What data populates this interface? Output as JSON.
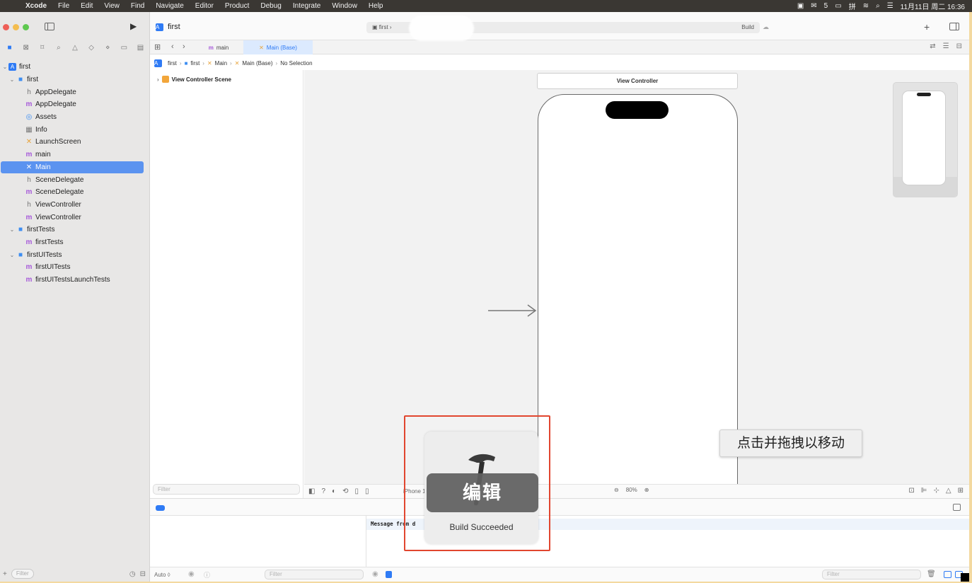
{
  "menubar": {
    "app": "Xcode",
    "items": [
      "File",
      "Edit",
      "View",
      "Find",
      "Navigate",
      "Editor",
      "Product",
      "Debug",
      "Integrate",
      "Window",
      "Help"
    ],
    "status": {
      "wechat_count": "5",
      "ime_badge": "拼",
      "datetime": "11月11日 周二 16:36"
    }
  },
  "toolbar": {
    "project_title": "first",
    "scheme": "first",
    "activity_status": "Build"
  },
  "navigator": {
    "tree": [
      {
        "label": "first",
        "icon": "project-icon",
        "level": 0,
        "disclosure": "open"
      },
      {
        "label": "first",
        "icon": "folder-icon",
        "level": 1,
        "disclosure": "open"
      },
      {
        "label": "AppDelegate",
        "icon": "h-file-icon",
        "level": 2
      },
      {
        "label": "AppDelegate",
        "icon": "m-file-icon",
        "level": 2
      },
      {
        "label": "Assets",
        "icon": "assets-icon",
        "level": 2
      },
      {
        "label": "Info",
        "icon": "plist-icon",
        "level": 2
      },
      {
        "label": "LaunchScreen",
        "icon": "storyboard-icon",
        "level": 2
      },
      {
        "label": "main",
        "icon": "m-file-icon",
        "level": 2
      },
      {
        "label": "Main",
        "icon": "storyboard-icon",
        "level": 2,
        "selected": true
      },
      {
        "label": "SceneDelegate",
        "icon": "h-file-icon",
        "level": 2
      },
      {
        "label": "SceneDelegate",
        "icon": "m-file-icon",
        "level": 2
      },
      {
        "label": "ViewController",
        "icon": "h-file-icon",
        "level": 2
      },
      {
        "label": "ViewController",
        "icon": "m-file-icon",
        "level": 2
      },
      {
        "label": "firstTests",
        "icon": "folder-icon",
        "level": 1,
        "disclosure": "open"
      },
      {
        "label": "firstTests",
        "icon": "m-file-icon",
        "level": 2
      },
      {
        "label": "firstUITests",
        "icon": "folder-icon",
        "level": 1,
        "disclosure": "open"
      },
      {
        "label": "firstUITests",
        "icon": "m-file-icon",
        "level": 2
      },
      {
        "label": "firstUITestsLaunchTests",
        "icon": "m-file-icon",
        "level": 2
      }
    ],
    "filter_placeholder": "Filter"
  },
  "tabs": [
    {
      "label": "main",
      "icon": "m-file-icon",
      "active": false
    },
    {
      "label": "Main (Base)",
      "icon": "storyboard-icon",
      "active": true
    }
  ],
  "jumpbar": [
    "first",
    "first",
    "Main",
    "Main (Base)",
    "No Selection"
  ],
  "outline": {
    "scene": "View Controller Scene",
    "filter_placeholder": "Filter"
  },
  "canvas": {
    "view_controller_title": "View Controller",
    "device": "iPhone 16",
    "zoom": "80%"
  },
  "debug": {
    "auto_label": "Auto ◊",
    "filter_placeholder": "Filter",
    "console_message": "Message from d"
  },
  "overlay": {
    "build_status": "Build Succeeded",
    "edit_label": "编辑",
    "drag_tip": "点击并拖拽以移动"
  },
  "colors": {
    "accent": "#2f7bf5",
    "selection": "#5b93f0",
    "highlight_border": "#e1462f",
    "traffic_close": "#ee5f57",
    "traffic_min": "#f4bd4f",
    "traffic_max": "#5ec84f"
  }
}
